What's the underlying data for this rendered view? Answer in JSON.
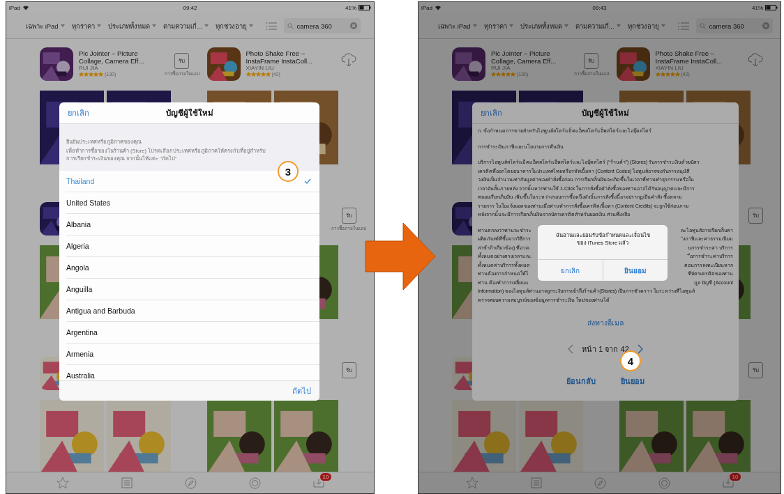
{
  "screens": [
    {
      "status": {
        "carrier": "iPad",
        "time": "09:42",
        "battery": "41%"
      },
      "filters": [
        {
          "label": "เฉพาะ iPad"
        },
        {
          "label": "ทุกราคา"
        },
        {
          "label": "ประเภททั้งหมด"
        },
        {
          "label": "ตามความเกี่..."
        },
        {
          "label": "ทุกช่วงอายุ"
        }
      ],
      "search": {
        "value": "camera 360"
      },
      "app_rows": [
        {
          "apps": [
            {
              "kind": "full",
              "title_lines": [
                "Pic Jointer – Picture",
                "Collage, Camera Eff..."
              ],
              "developer": "RUI JIA",
              "stars": 5,
              "count": "(130)",
              "action": {
                "kind": "get",
                "label": "รับ",
                "note": "การซื้อภายในแอป"
              }
            },
            {
              "kind": "full",
              "title_lines": [
                "Photo Shake Free –",
                "InstaFrame InstaColl..."
              ],
              "developer": "XIAYIN LIU",
              "stars": 5,
              "count": "(42)",
              "action": {
                "kind": "download"
              }
            }
          ]
        },
        {
          "apps": [
            {
              "kind": "icon_only"
            },
            {
              "kind": "action_only",
              "action": {
                "kind": "get",
                "label": "รับ",
                "note": "การซื้อภายในแอป"
              }
            }
          ]
        },
        {
          "apps": [
            {
              "kind": "icon_only"
            },
            {
              "kind": "action_only",
              "action": {
                "kind": "get",
                "label": "รับ"
              }
            }
          ]
        }
      ],
      "tabbar": {
        "badge": "10"
      },
      "modal": {
        "kind": "country_list",
        "cancel": "ยกเลิก",
        "title": "บัญชีผู้ใช้ใหม่",
        "heading": "ยืนยันประเทศหรือภูมิภาคของคุณ",
        "description_lines": [
          "เพื่อทำการซื้อของในร้านค้า (Store) โปรดเลือกประเทศหรือภูมิภาคให้ตรงกับที่อยู่สำหรับ",
          "การเรียกชำระเงินของคุณ จากนั้นให้แตะ \"ถัดไป\""
        ],
        "countries": [
          {
            "name": "Thailand",
            "selected": true
          },
          {
            "name": "United States",
            "selected": false
          },
          {
            "name": "Albania",
            "selected": false
          },
          {
            "name": "Algeria",
            "selected": false
          },
          {
            "name": "Angola",
            "selected": false
          },
          {
            "name": "Anguilla",
            "selected": false
          },
          {
            "name": "Antigua and Barbuda",
            "selected": false
          },
          {
            "name": "Argentina",
            "selected": false
          },
          {
            "name": "Armenia",
            "selected": false
          },
          {
            "name": "Australia",
            "selected": false
          }
        ],
        "next": "ถัดไป",
        "callout": "3"
      }
    },
    {
      "status": {
        "carrier": "iPad",
        "time": "09:43",
        "battery": "41%"
      },
      "filters": [
        {
          "label": "เฉพาะ iPad"
        },
        {
          "label": "ทุกราคา"
        },
        {
          "label": "ประเภททั้งหมด"
        },
        {
          "label": "ตามความเกี่..."
        },
        {
          "label": "ทุกช่วงอายุ"
        }
      ],
      "search": {
        "value": "camera 360"
      },
      "app_rows": [
        {
          "apps": [
            {
              "kind": "full",
              "title_lines": [
                "Pic Jointer – Picture",
                "Collage, Camera Eff..."
              ],
              "developer": "RUI JIA",
              "stars": 5,
              "count": "(130)",
              "action": {
                "kind": "get",
                "label": "รับ",
                "note": "การซื้อภายในแอป"
              }
            },
            {
              "kind": "full",
              "title_lines": [
                "Photo Shake Free –",
                "InstaFrame InstaColl..."
              ],
              "developer": "XIAYIN LIU",
              "stars": 5,
              "count": "(42)",
              "action": {
                "kind": "download"
              }
            }
          ]
        },
        {
          "apps": [
            {
              "kind": "icon_only"
            },
            {
              "kind": "action_only",
              "action": {
                "kind": "get",
                "label": "รับ"
              }
            }
          ]
        },
        {
          "apps": [
            {
              "kind": "icon_only"
            },
            {
              "kind": "action_only",
              "action": {
                "kind": "get",
                "label": "รับ"
              }
            }
          ]
        }
      ],
      "tabbar": {
        "badge": "10"
      },
      "modal": {
        "kind": "terms",
        "cancel": "ยกเลิก",
        "title": "บัญชีผู้ใช้ใหม่",
        "paragraphs": [
          [
            "ก. ข้อกำหนดการขายสำหรับไอทูนส์สโตร์แม็คแอ็พสโตร์แอ็พสโตร์และไอบุ๊คสโตร์"
          ],
          [
            "การชำระเงินภาษีและนโยบายการคืนเงิน"
          ],
          [
            "บริการไอทูนส์สโตร์แม็คแอ็พสโตร์แอ็พสโตร์และไอบุ๊คสโตร์ (“ร้านค้า”) (Stores) รับการชำระเงินด้วยบัตร",
            "เครดิตที่ออกโดยธนาคารในประเทศไทยหรือรหัสเนื้อหา (Content Codes) ไอทูนส์อาจขอรับการอนุมัติ",
            "วงเงินเป็นจำนวนเท่ากับมูลค่าของคำสั่งซื้อก่อน การเรียกเก็บเงินจะเกิดขึ้นในเวลาที่ท่านทำธุรกรรมหรือใน",
            "เวลาอันสั้นภายหลัง จากนั้นหากท่านใช้ 1-Click ในการสั่งซื้อคำสั่งซื้อของท่านอาจได้รับอนุญาตและมีการ",
            "ทยอยเรียกเก็บเงิน เพิ่มขึ้นในระหว่างรอบการซื้อหนึ่งดังนั้นการสั่งซื้อนี้อาจปรากฏเป็นคำสั่ง ซื้อหลาย",
            "รายการ ในใบแจ้งยอดของท่านเมื่อท่านทำการสั่งซื้อเครดิตเนื้อหา (Content Credits) จะถูกใช้ก่อนภาย",
            "หลังจากนั้นจะมีการเรียกเก็บเงินจากบัตรเครดิตสำหรับยอดเงิน ส่วนที่เหลือ"
          ]
        ],
        "covered_lines": [
          {
            "left": "ท่านตกลงว่าท่านจะชำระ",
            "right": "ละไอทูนส์อาจเรียกเก็บค่า"
          },
          {
            "left": "ผลิตภัณฑ์ที่ซื้อจากวิธีการ",
            "right": "ังภาษีและค่าธรรมเนียม"
          },
          {
            "left": "ล่าช้าถ้าเกี่ยวข้อง) ที่อาจเ",
            "right": "นการชำระค่า บริการ"
          },
          {
            "left": "ทั้งหมดอย่างตรงเวลาและ",
            "right": "ื่อการชำระค่าบริการ"
          },
          {
            "left": "ทั้งหมดค่าบริการทั้งหมด",
            "right": "ตอนการลงทะเบียนหาก"
          },
          {
            "left": "ท่านต้องการกำหนดให้ไ",
            "right": "ชีบัตรเครดิตของท่าน"
          },
          {
            "left": "ท่าน ต้องทำการเปลี่ยนแ",
            "right": "มูล บัญชี (Account"
          }
        ],
        "tail_lines": [
          "Information) ของไอทูนส์ท่านอาจถูกระงับการเข้าถึงร้านค้า(Stores) เป็นการชั่วคราว ในระหว่างที่ไอทูนส์",
          "ตรวจสอบความสมบูรณ์ของข้อมูลการชำระเงิน ใหม่ของท่านได้"
        ],
        "email_link": "ส่งทางอีเมล",
        "page": "หน้า 1 จาก 42",
        "back": "ย้อนกลับ",
        "agree": "ยินยอม",
        "callout": "4",
        "alert": {
          "message": "ฉันอ่านและยอมรับข้อกำหนดและเงื่อนไขของ iTunes Store แล้ว",
          "cancel": "ยกเลิก",
          "confirm": "ยินยอม"
        }
      }
    }
  ]
}
